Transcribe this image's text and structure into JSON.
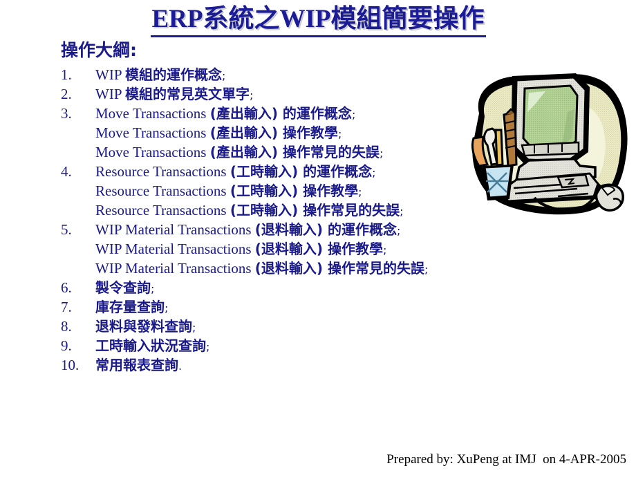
{
  "slide": {
    "title": "ERP系統之WIP模組簡要操作",
    "heading": "操作大綱:",
    "footer": "Prepared by: XuPeng at IMJ  on 4-APR-2005",
    "colors": {
      "title_blue": "#1c1c96",
      "body_blue": "#1a1a8c",
      "footer_black": "#000000",
      "background": "#ffffff",
      "clipart_blob": "#e9e9c4",
      "clipart_blob_ring": "#cfcf94",
      "clipart_screen": "#a9c98c",
      "clipart_case": "#dcdcd2",
      "clipart_outline": "#000000",
      "clipart_cup": "#bfe0ef",
      "clipart_pencil": "#e8a45c",
      "clipart_ruler": "#b07a3c"
    }
  },
  "outline": {
    "items": [
      {
        "number": "1.",
        "lines": [
          [
            {
              "t": "WIP ",
              "s": "lat"
            },
            {
              "t": "模組的運作概念",
              "s": "cjk"
            },
            {
              "t": ";",
              "s": "semi"
            }
          ]
        ]
      },
      {
        "number": "2.",
        "lines": [
          [
            {
              "t": "WIP ",
              "s": "lat"
            },
            {
              "t": "模組的常見英文單字",
              "s": "cjk"
            },
            {
              "t": ";",
              "s": "semi"
            }
          ]
        ]
      },
      {
        "number": "3.",
        "lines": [
          [
            {
              "t": "Move Transactions ",
              "s": "lat"
            },
            {
              "t": "(產出輸入) 的運作概念",
              "s": "cjk"
            },
            {
              "t": ";",
              "s": "semi"
            }
          ],
          [
            {
              "t": "Move Transactions ",
              "s": "lat"
            },
            {
              "t": "(產出輸入) 操作教學",
              "s": "cjk"
            },
            {
              "t": ";",
              "s": "semi"
            }
          ],
          [
            {
              "t": "Move Transactions ",
              "s": "lat"
            },
            {
              "t": "(產出輸入) 操作常見的失誤",
              "s": "cjk"
            },
            {
              "t": ";",
              "s": "semi"
            }
          ]
        ]
      },
      {
        "number": "4.",
        "lines": [
          [
            {
              "t": "Resource Transactions ",
              "s": "lat"
            },
            {
              "t": "(工時輸入) 的運作概念",
              "s": "cjk"
            },
            {
              "t": ";",
              "s": "semi"
            }
          ],
          [
            {
              "t": "Resource Transactions ",
              "s": "lat"
            },
            {
              "t": "(工時輸入) 操作教學",
              "s": "cjk"
            },
            {
              "t": ";",
              "s": "semi"
            }
          ],
          [
            {
              "t": "Resource Transactions ",
              "s": "lat"
            },
            {
              "t": "(工時輸入) 操作常見的失誤",
              "s": "cjk"
            },
            {
              "t": ";",
              "s": "semi"
            }
          ]
        ]
      },
      {
        "number": "5.",
        "lines": [
          [
            {
              "t": "WIP Material Transactions ",
              "s": "lat"
            },
            {
              "t": "(退料輸入) 的運作概念",
              "s": "cjk"
            },
            {
              "t": ";",
              "s": "semi"
            }
          ],
          [
            {
              "t": "WIP Material Transactions ",
              "s": "lat"
            },
            {
              "t": "(退料輸入) 操作教學",
              "s": "cjk"
            },
            {
              "t": ";",
              "s": "semi"
            }
          ],
          [
            {
              "t": "WIP Material Transactions ",
              "s": "lat"
            },
            {
              "t": "(退料輸入) 操作常見的失誤",
              "s": "cjk"
            },
            {
              "t": ";",
              "s": "semi"
            }
          ]
        ]
      },
      {
        "number": "6.",
        "lines": [
          [
            {
              "t": "製令查詢",
              "s": "cjk"
            },
            {
              "t": ";",
              "s": "semi"
            }
          ]
        ]
      },
      {
        "number": "7.",
        "lines": [
          [
            {
              "t": "庫存量查詢",
              "s": "cjk"
            },
            {
              "t": ";",
              "s": "semi"
            }
          ]
        ]
      },
      {
        "number": "8.",
        "lines": [
          [
            {
              "t": "退料與發料查詢",
              "s": "cjk"
            },
            {
              "t": ";",
              "s": "semi"
            }
          ]
        ]
      },
      {
        "number": "9.",
        "lines": [
          [
            {
              "t": "工時輸入狀況查詢",
              "s": "cjk"
            },
            {
              "t": ";",
              "s": "semi"
            }
          ]
        ]
      },
      {
        "number": "10.",
        "lines": [
          [
            {
              "t": "常用報表查詢",
              "s": "cjk"
            },
            {
              "t": ".",
              "s": "semi"
            }
          ]
        ]
      }
    ]
  },
  "clipart": {
    "name": "desktop-computer-clipart",
    "parts": [
      "blob-background",
      "crt-monitor",
      "monitor-screen",
      "computer-tower-base",
      "keyboard",
      "mouse",
      "mouse-cable",
      "pencil-cup",
      "pencils",
      "ruler"
    ]
  }
}
